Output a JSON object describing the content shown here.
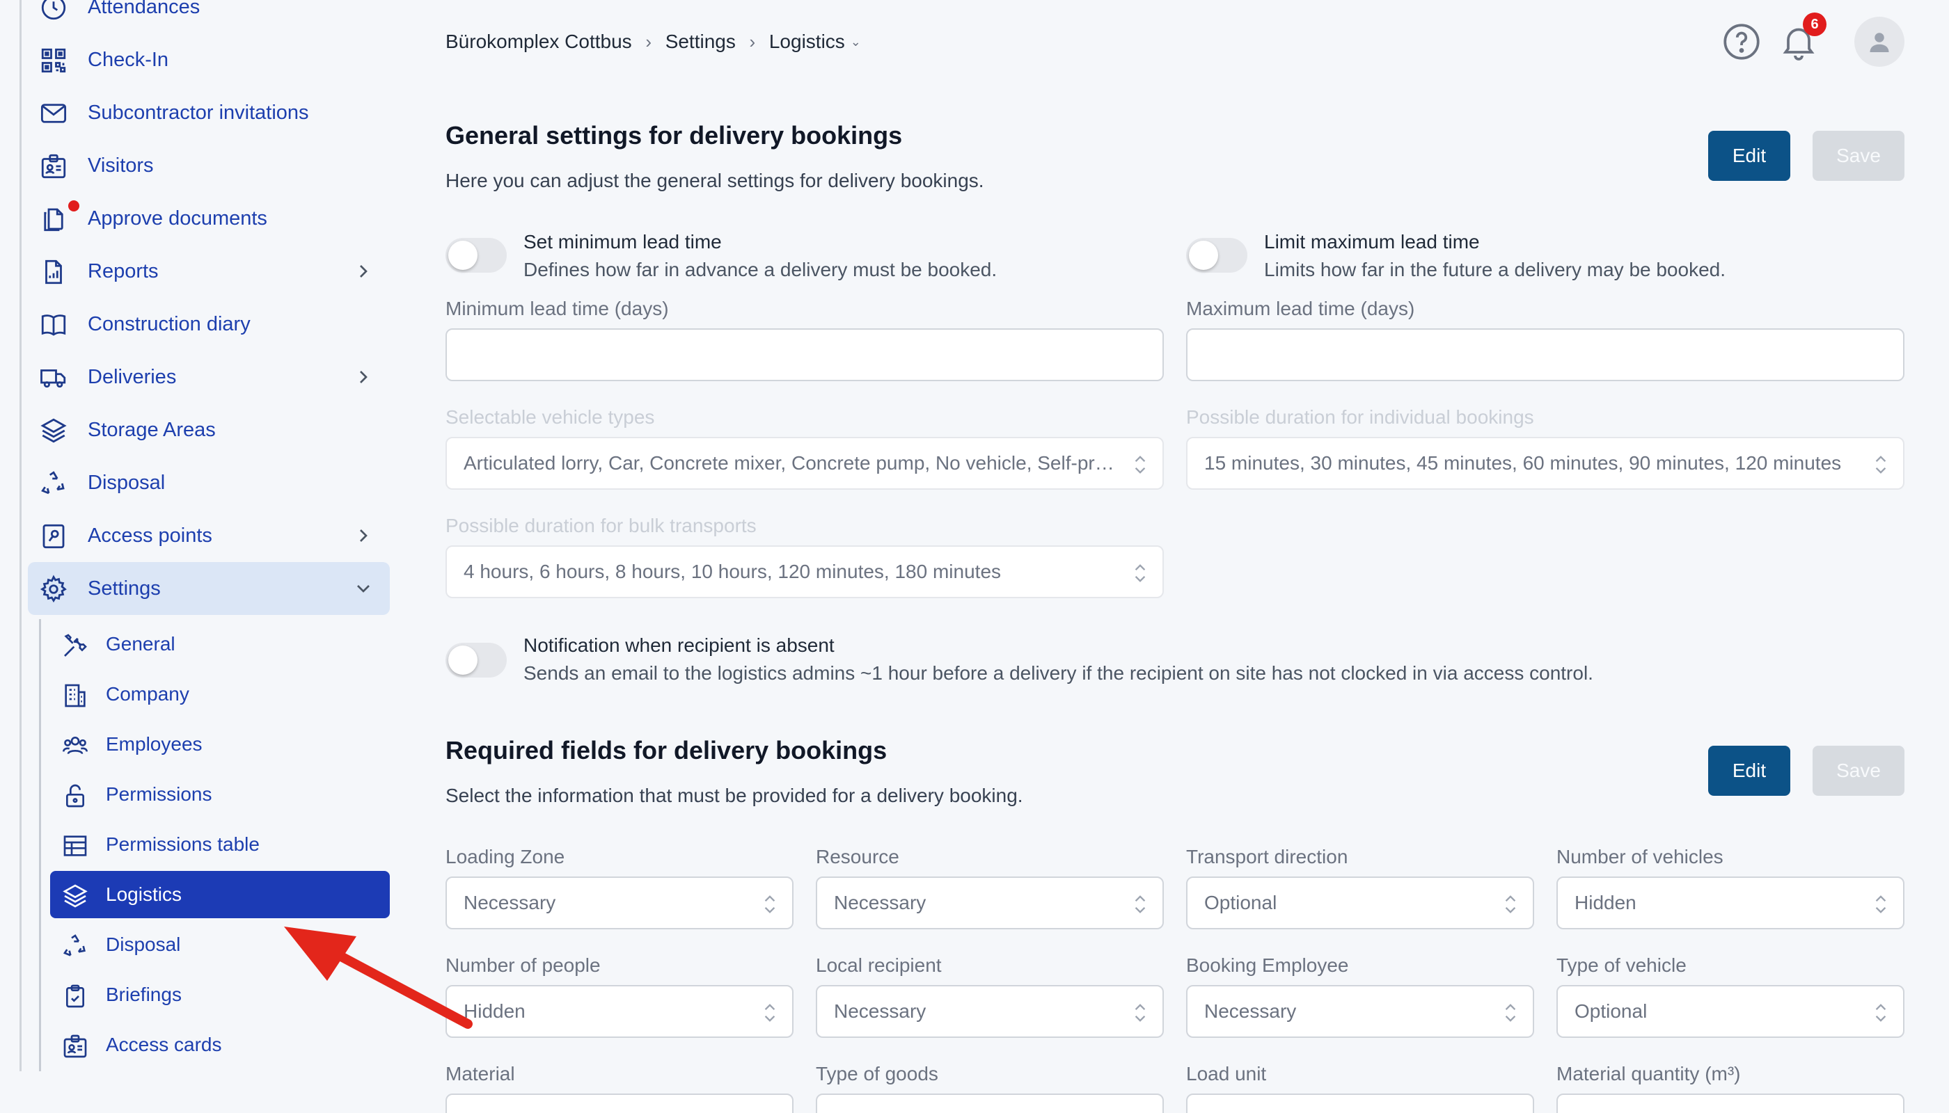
{
  "sidebar": {
    "items": [
      {
        "label": "Attendances",
        "icon": "clock-icon"
      },
      {
        "label": "Check-In",
        "icon": "qr-code-icon"
      },
      {
        "label": "Subcontractor invitations",
        "icon": "envelope-icon"
      },
      {
        "label": "Visitors",
        "icon": "id-badge-icon"
      },
      {
        "label": "Approve documents",
        "icon": "documents-icon"
      },
      {
        "label": "Reports",
        "icon": "report-icon"
      },
      {
        "label": "Construction diary",
        "icon": "book-icon"
      },
      {
        "label": "Deliveries",
        "icon": "truck-icon"
      },
      {
        "label": "Storage Areas",
        "icon": "layers-icon"
      },
      {
        "label": "Disposal",
        "icon": "recycle-icon"
      },
      {
        "label": "Access points",
        "icon": "access-point-icon"
      },
      {
        "label": "Settings",
        "icon": "gear-icon"
      }
    ],
    "settings_sub": [
      {
        "label": "General",
        "icon": "tools-icon"
      },
      {
        "label": "Company",
        "icon": "building-icon"
      },
      {
        "label": "Employees",
        "icon": "users-icon"
      },
      {
        "label": "Permissions",
        "icon": "lock-icon"
      },
      {
        "label": "Permissions table",
        "icon": "table-icon"
      },
      {
        "label": "Logistics",
        "icon": "layers-icon"
      },
      {
        "label": "Disposal",
        "icon": "recycle-icon"
      },
      {
        "label": "Briefings",
        "icon": "clipboard-icon"
      },
      {
        "label": "Access cards",
        "icon": "id-badge-icon"
      }
    ]
  },
  "header": {
    "breadcrumb": [
      "Bürokomplex Cottbus",
      "Settings",
      "Logistics"
    ],
    "notification_count": "6"
  },
  "general": {
    "title": "General settings for delivery bookings",
    "description": "Here you can adjust the general settings for delivery bookings.",
    "edit_label": "Edit",
    "save_label": "Save",
    "min_toggle_title": "Set minimum lead time",
    "min_toggle_desc": "Defines how far in advance a delivery must be booked.",
    "max_toggle_title": "Limit maximum lead time",
    "max_toggle_desc": "Limits how far in the future a delivery may be booked.",
    "min_label": "Minimum lead time (days)",
    "max_label": "Maximum lead time (days)",
    "vehicle_label": "Selectable vehicle types",
    "vehicle_value": "Articulated lorry, Car, Concrete mixer, Concrete pump, No vehicle, Self-propelled crane",
    "duration_label": "Possible duration for individual bookings",
    "duration_value": "15 minutes, 30 minutes, 45 minutes, 60 minutes, 90 minutes, 120 minutes",
    "bulk_label": "Possible duration for bulk transports",
    "bulk_value": "4 hours, 6 hours, 8 hours, 10 hours, 120 minutes, 180 minutes",
    "notif_title": "Notification when recipient is absent",
    "notif_desc": "Sends an email to the logistics admins ~1 hour before a delivery if the recipient on site has not clocked in via access control."
  },
  "required": {
    "title": "Required fields for delivery bookings",
    "description": "Select the information that must be provided for a delivery booking.",
    "edit_label": "Edit",
    "save_label": "Save",
    "fields": [
      {
        "label": "Loading Zone",
        "value": "Necessary"
      },
      {
        "label": "Resource",
        "value": "Necessary"
      },
      {
        "label": "Transport direction",
        "value": "Optional"
      },
      {
        "label": "Number of vehicles",
        "value": "Hidden"
      },
      {
        "label": "Number of people",
        "value": "Hidden"
      },
      {
        "label": "Local recipient",
        "value": "Necessary"
      },
      {
        "label": "Booking Employee",
        "value": "Necessary"
      },
      {
        "label": "Type of vehicle",
        "value": "Optional"
      },
      {
        "label": "Material",
        "value": ""
      },
      {
        "label": "Type of goods",
        "value": ""
      },
      {
        "label": "Load unit",
        "value": ""
      },
      {
        "label": "Material quantity (m³)",
        "value": ""
      }
    ]
  },
  "colors": {
    "primary": "#0c5287",
    "nav_text": "#1d3fae",
    "selected_bg": "#1c3bb5",
    "badge": "#e11d1d",
    "annotation_arrow": "#e3261b"
  }
}
